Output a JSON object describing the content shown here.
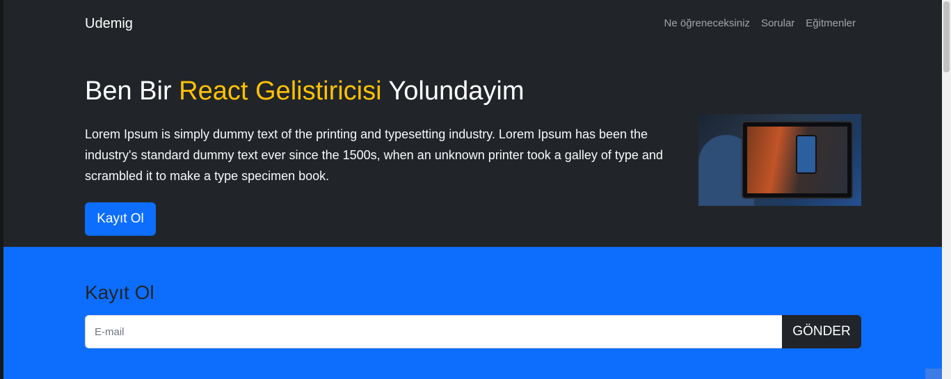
{
  "navbar": {
    "brand": "Udemig",
    "links": [
      "Ne öğreneceksiniz",
      "Sorular",
      "Eğitmenler"
    ]
  },
  "hero": {
    "title_before": "Ben Bir ",
    "title_accent": "React Gelistiricisi",
    "title_after": " Yolundayim",
    "description": "Lorem Ipsum is simply dummy text of the printing and typesetting industry. Lorem Ipsum has been the industry's standard dummy text ever since the 1500s, when an unknown printer took a galley of type and scrambled it to make a type specimen book.",
    "button_label": "Kayıt Ol"
  },
  "signup": {
    "title": "Kayıt Ol",
    "email_placeholder": "E-mail",
    "submit_label": "GÖNDER"
  },
  "colors": {
    "dark_bg": "#212529",
    "accent": "#ffc107",
    "primary": "#0d6efd"
  }
}
